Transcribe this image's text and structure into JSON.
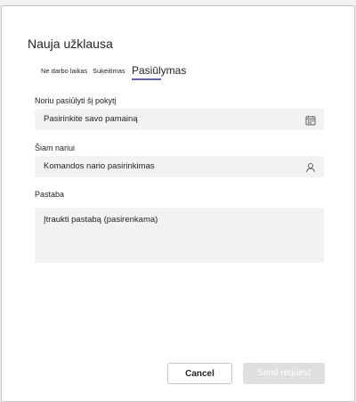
{
  "backdrop": {
    "partial_text": "... ... ..... .... .. ...."
  },
  "dialog": {
    "title": "Nauja užklausa",
    "tabs": [
      {
        "label": "Ne darbo laikas",
        "active": false
      },
      {
        "label": "Sukeitimas",
        "active": false
      },
      {
        "label": "Pasiūlymas",
        "active": true
      }
    ],
    "offer_shift": {
      "label": "Noriu pasiūlyti šį pokytį",
      "value": "Pasirinkite savo pamainą",
      "icon": "calendar-icon"
    },
    "member": {
      "label": "Šiam nariui",
      "value": "Komandos nario pasirinkimas",
      "icon": "person-icon"
    },
    "note": {
      "label": "Pastaba",
      "placeholder": "Įtraukti pastabą (pasirenkama)"
    },
    "buttons": {
      "cancel": "Cancel",
      "send": "Send request"
    }
  },
  "colors": {
    "accent": "#6264a7",
    "field_bg": "#f3f2f1",
    "disabled_button": "#e1dfdd"
  }
}
